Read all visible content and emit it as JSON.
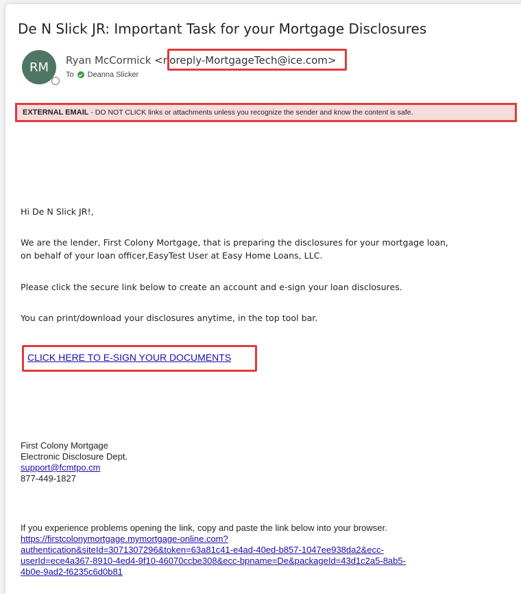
{
  "email": {
    "subject": "De N Slick JR: Important Task for your Mortgage Disclosures",
    "sender": {
      "initials": "RM",
      "name": "Ryan McCormick",
      "address_open": "<",
      "address": "noreply-MortgageTech@ice.com",
      "address_close": ">"
    },
    "to_label": "To",
    "recipient": "Deanna Slicker",
    "banner": {
      "bold": "EXTERNAL EMAIL",
      "text": "- DO NOT CLICK links or attachments unless you recognize the sender and know the content is safe."
    },
    "greeting": "Hi De N Slick JR!,",
    "para1_line1": "We are the lender, First Colony Mortgage, that is preparing the disclosures for your mortgage loan,",
    "para1_line2": "on behalf of your loan officer,EasyTest User at Easy Home Loans, LLC.",
    "para2": "Please click the secure link below to create an account and e-sign your loan disclosures.",
    "para3": "You can print/download your disclosures anytime, in the top tool bar.",
    "cta_link": "CLICK HERE TO E-SIGN YOUR DOCUMENTS",
    "signature": {
      "company": "First Colony Mortgage",
      "dept": "Electronic Disclosure Dept.",
      "email": "support@fcmtpo.cm",
      "phone": "877-449-1827"
    },
    "trouble_text": "If you experience problems opening the link, copy and paste the link below into your browser.",
    "url_lines": [
      "https://firstcolonymortgage.mymortgage-online.com?",
      "authentication&siteId=3071307296&token=63a81c41-e4ad-40ed-b857-1047ee938da2&ecc-",
      "userId=ece4a367-8910-4ed4-9f10-46070ccbe308&ecc-bpname=De&packageId=43d1c2a5-8ab5-",
      "4b0e-9ad2-f6235c6d0b81"
    ]
  },
  "colors": {
    "highlight_border": "#e23a3a",
    "banner_bg": "#f7dcdc",
    "link": "#1a0dab",
    "avatar_bg": "#4f7565"
  }
}
